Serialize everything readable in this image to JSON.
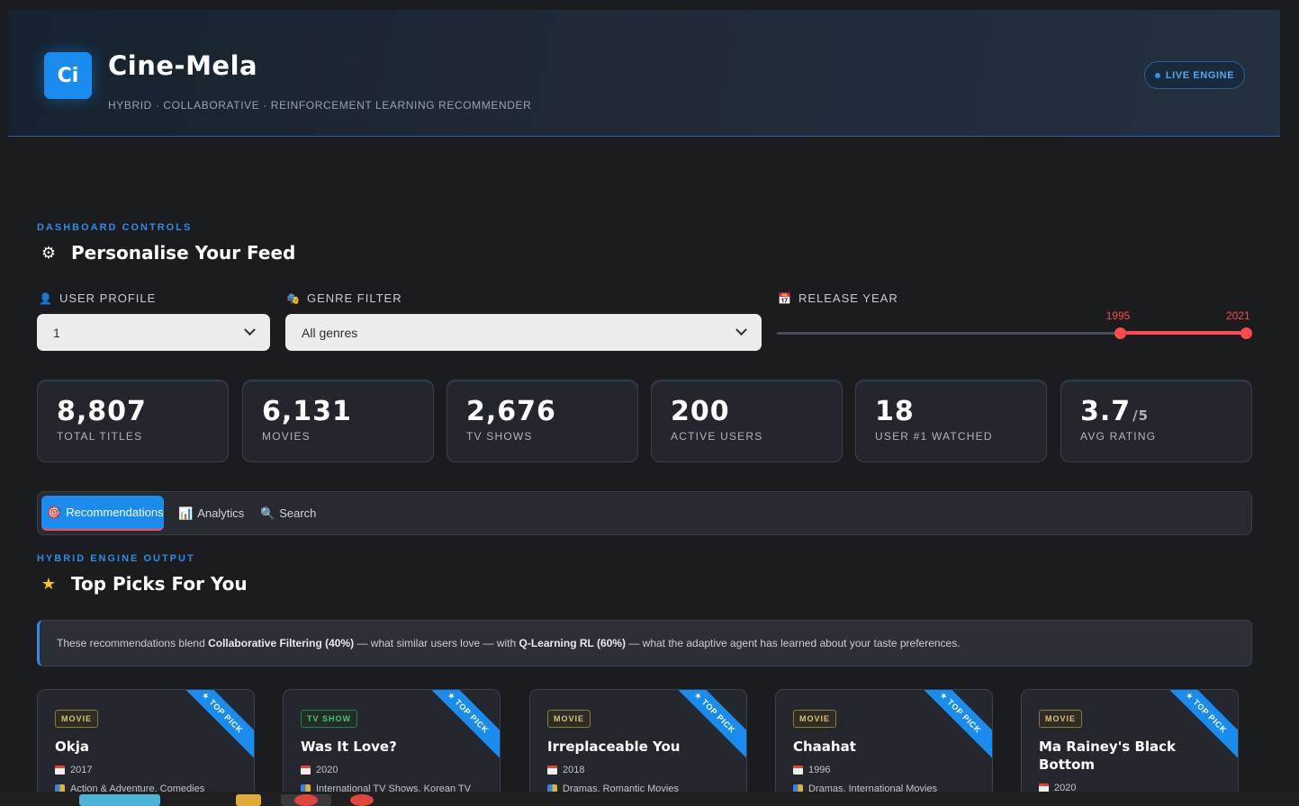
{
  "header": {
    "logo_text": "Ci",
    "title": "Cine-Mela",
    "subtitle": "HYBRID · COLLABORATIVE · REINFORCEMENT LEARNING RECOMMENDER",
    "badge": "LIVE ENGINE"
  },
  "controls": {
    "eyebrow": "DASHBOARD CONTROLS",
    "title": "Personalise Your Feed",
    "user_profile": {
      "label": "USER PROFILE",
      "value": "1"
    },
    "genre_filter": {
      "label": "GENRE FILTER",
      "value": "All genres"
    },
    "release_year": {
      "label": "RELEASE YEAR",
      "min": 1925,
      "max": 2021,
      "low": "1995",
      "high": "2021"
    }
  },
  "stats": [
    {
      "value": "8,807",
      "suffix": "",
      "label": "TOTAL TITLES"
    },
    {
      "value": "6,131",
      "suffix": "",
      "label": "MOVIES"
    },
    {
      "value": "2,676",
      "suffix": "",
      "label": "TV SHOWS"
    },
    {
      "value": "200",
      "suffix": "",
      "label": "ACTIVE USERS"
    },
    {
      "value": "18",
      "suffix": "",
      "label": "USER #1 WATCHED"
    },
    {
      "value": "3.7",
      "suffix": "/5",
      "label": "AVG RATING"
    }
  ],
  "tabs": [
    {
      "label": "Recommendations",
      "icon": "target-icon",
      "active": true
    },
    {
      "label": "Analytics",
      "icon": "bar-chart-icon",
      "active": false
    },
    {
      "label": "Search",
      "icon": "magnifier-icon",
      "active": false
    }
  ],
  "output": {
    "eyebrow": "HYBRID ENGINE OUTPUT",
    "title": "Top Picks For You",
    "info_prefix": "These recommendations blend ",
    "info_cf": "Collaborative Filtering (40%)",
    "info_mid": " — what similar users love — with ",
    "info_rl": "Q-Learning RL (60%)",
    "info_suffix": " — what the adaptive agent has learned about your taste preferences."
  },
  "ribbon_label": "TOP PICK",
  "cards": [
    {
      "type": "MOVIE",
      "title": "Okja",
      "year": "2017",
      "genres": "Action & Adventure, Comedies"
    },
    {
      "type": "TV SHOW",
      "title": "Was It Love?",
      "year": "2020",
      "genres": "International TV Shows, Korean TV"
    },
    {
      "type": "MOVIE",
      "title": "Irreplaceable You",
      "year": "2018",
      "genres": "Dramas, Romantic Movies"
    },
    {
      "type": "MOVIE",
      "title": "Chaahat",
      "year": "1996",
      "genres": "Dramas, International Movies"
    },
    {
      "type": "MOVIE",
      "title": "Ma Rainey's Black Bottom",
      "year": "2020",
      "genres": ""
    }
  ],
  "colors": {
    "accent": "#1a8cf0",
    "slider": "#ff4b4b",
    "background": "#1a1c20"
  }
}
